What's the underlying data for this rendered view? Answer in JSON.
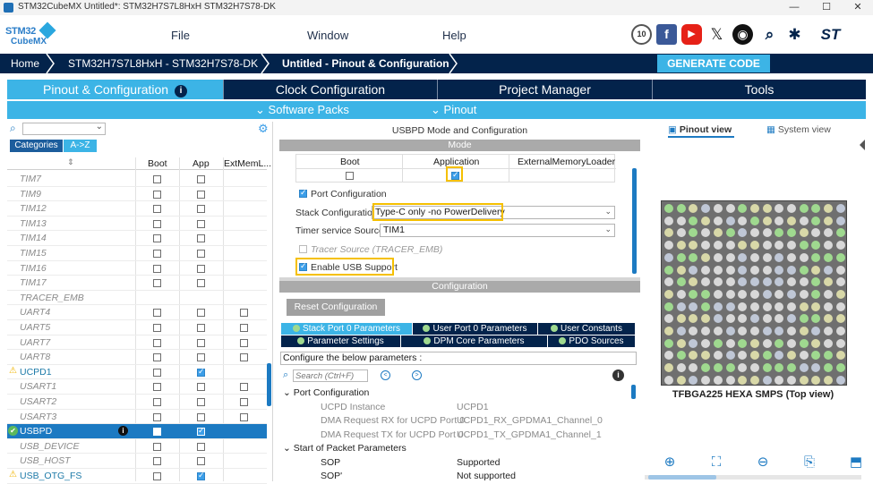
{
  "window": {
    "title": "STM32CubeMX Untitled*: STM32H7S7L8HxH STM32H7S78-DK",
    "minimize": "—",
    "maximize": "☐",
    "close": "✕"
  },
  "logo": {
    "line1": "STM32",
    "line2": "CubeMX"
  },
  "menu": {
    "file": "File",
    "window": "Window",
    "help": "Help"
  },
  "social_icons": [
    "anniversary-10-icon",
    "facebook-icon",
    "youtube-icon",
    "x-icon",
    "github-icon",
    "community-search-icon",
    "network-icon",
    "st-logo-icon"
  ],
  "breadcrumb": {
    "home": "Home",
    "device": "STM32H7S7L8HxH - STM32H7S78-DK",
    "current": "Untitled - Pinout & Configuration"
  },
  "generate_button": "GENERATE CODE",
  "main_tabs": {
    "pinout": "Pinout & Configuration",
    "clock": "Clock Configuration",
    "project": "Project Manager",
    "tools": "Tools"
  },
  "sub_tabs": {
    "software_packs": "Software Packs",
    "pinout": "Pinout"
  },
  "left_panel": {
    "tab_categories": "Categories",
    "tab_az": "A->Z",
    "columns": {
      "boot": "Boot",
      "app": "App",
      "extmem": "ExtMemL..."
    },
    "rows": [
      {
        "name": "TIM7",
        "boot": false,
        "app": false,
        "ext": null,
        "enabled": false
      },
      {
        "name": "TIM9",
        "boot": false,
        "app": false,
        "ext": null,
        "enabled": false
      },
      {
        "name": "TIM12",
        "boot": false,
        "app": false,
        "ext": null,
        "enabled": false
      },
      {
        "name": "TIM13",
        "boot": false,
        "app": false,
        "ext": null,
        "enabled": false
      },
      {
        "name": "TIM14",
        "boot": false,
        "app": false,
        "ext": null,
        "enabled": false
      },
      {
        "name": "TIM15",
        "boot": false,
        "app": false,
        "ext": null,
        "enabled": false
      },
      {
        "name": "TIM16",
        "boot": false,
        "app": false,
        "ext": null,
        "enabled": false
      },
      {
        "name": "TIM17",
        "boot": false,
        "app": false,
        "ext": null,
        "enabled": false
      },
      {
        "name": "TRACER_EMB",
        "boot": null,
        "app": null,
        "ext": null,
        "enabled": false
      },
      {
        "name": "UART4",
        "boot": false,
        "app": false,
        "ext": false,
        "enabled": false
      },
      {
        "name": "UART5",
        "boot": false,
        "app": false,
        "ext": false,
        "enabled": false
      },
      {
        "name": "UART7",
        "boot": false,
        "app": false,
        "ext": false,
        "enabled": false
      },
      {
        "name": "UART8",
        "boot": false,
        "app": false,
        "ext": false,
        "enabled": false
      },
      {
        "name": "UCPD1",
        "boot": false,
        "app": true,
        "ext": null,
        "enabled": true,
        "status": "warning"
      },
      {
        "name": "USART1",
        "boot": false,
        "app": false,
        "ext": false,
        "enabled": false
      },
      {
        "name": "USART2",
        "boot": false,
        "app": false,
        "ext": false,
        "enabled": false
      },
      {
        "name": "USART3",
        "boot": false,
        "app": false,
        "ext": false,
        "enabled": false
      },
      {
        "name": "USBPD",
        "boot": false,
        "app": true,
        "ext": null,
        "enabled": true,
        "selected": true,
        "status": "ok"
      },
      {
        "name": "USB_DEVICE",
        "boot": false,
        "app": false,
        "ext": null,
        "enabled": false
      },
      {
        "name": "USB_HOST",
        "boot": false,
        "app": false,
        "ext": null,
        "enabled": false
      },
      {
        "name": "USB_OTG_FS",
        "boot": false,
        "app": true,
        "ext": null,
        "enabled": true,
        "status": "warning"
      }
    ]
  },
  "mode_panel": {
    "title": "USBPD Mode and Configuration",
    "mode_header": "Mode",
    "cols": {
      "boot": "Boot",
      "application": "Application",
      "extmem": "ExternalMemoryLoader"
    },
    "port_config_label": "Port Configuration",
    "stack_label": "Stack Configuration",
    "stack_value": "Type-C only -no PowerDelivery",
    "timer_label": "Timer service Source",
    "timer_value": "TIM1",
    "tracer_label": "Tracer Source (TRACER_EMB)",
    "enable_usb_label": "Enable USB Support"
  },
  "config_panel": {
    "header": "Configuration",
    "reset_button": "Reset Configuration",
    "tabs_row1": [
      "Stack Port 0 Parameters",
      "User Port 0 Parameters",
      "User Constants"
    ],
    "tabs_row2": [
      "Parameter Settings",
      "DPM Core Parameters",
      "PDO Sources"
    ],
    "hint": "Configure the below parameters :",
    "search_placeholder": "Search (Ctrl+F)",
    "group1": "Port Configuration",
    "params1": [
      {
        "k": "UCPD Instance",
        "v": "UCPD1"
      },
      {
        "k": "DMA Request RX for UCPD Port 0",
        "v": "UCPD1_RX_GPDMA1_Channel_0"
      },
      {
        "k": "DMA Request TX for UCPD Port 0",
        "v": "UCPD1_TX_GPDMA1_Channel_1"
      }
    ],
    "group2": "Start of Packet Parameters",
    "params2": [
      {
        "k": "SOP",
        "v": "Supported"
      },
      {
        "k": "SOP'",
        "v": "Not supported"
      }
    ]
  },
  "right_panel": {
    "pinout_view": "Pinout view",
    "system_view": "System view",
    "chip_caption": "TFBGA225 HEXA SMPS (Top view)"
  },
  "colors": {
    "navy": "#03234b",
    "accent": "#3cb4e6",
    "highlight": "#f5c000",
    "selected_row": "#1c7ac2"
  }
}
